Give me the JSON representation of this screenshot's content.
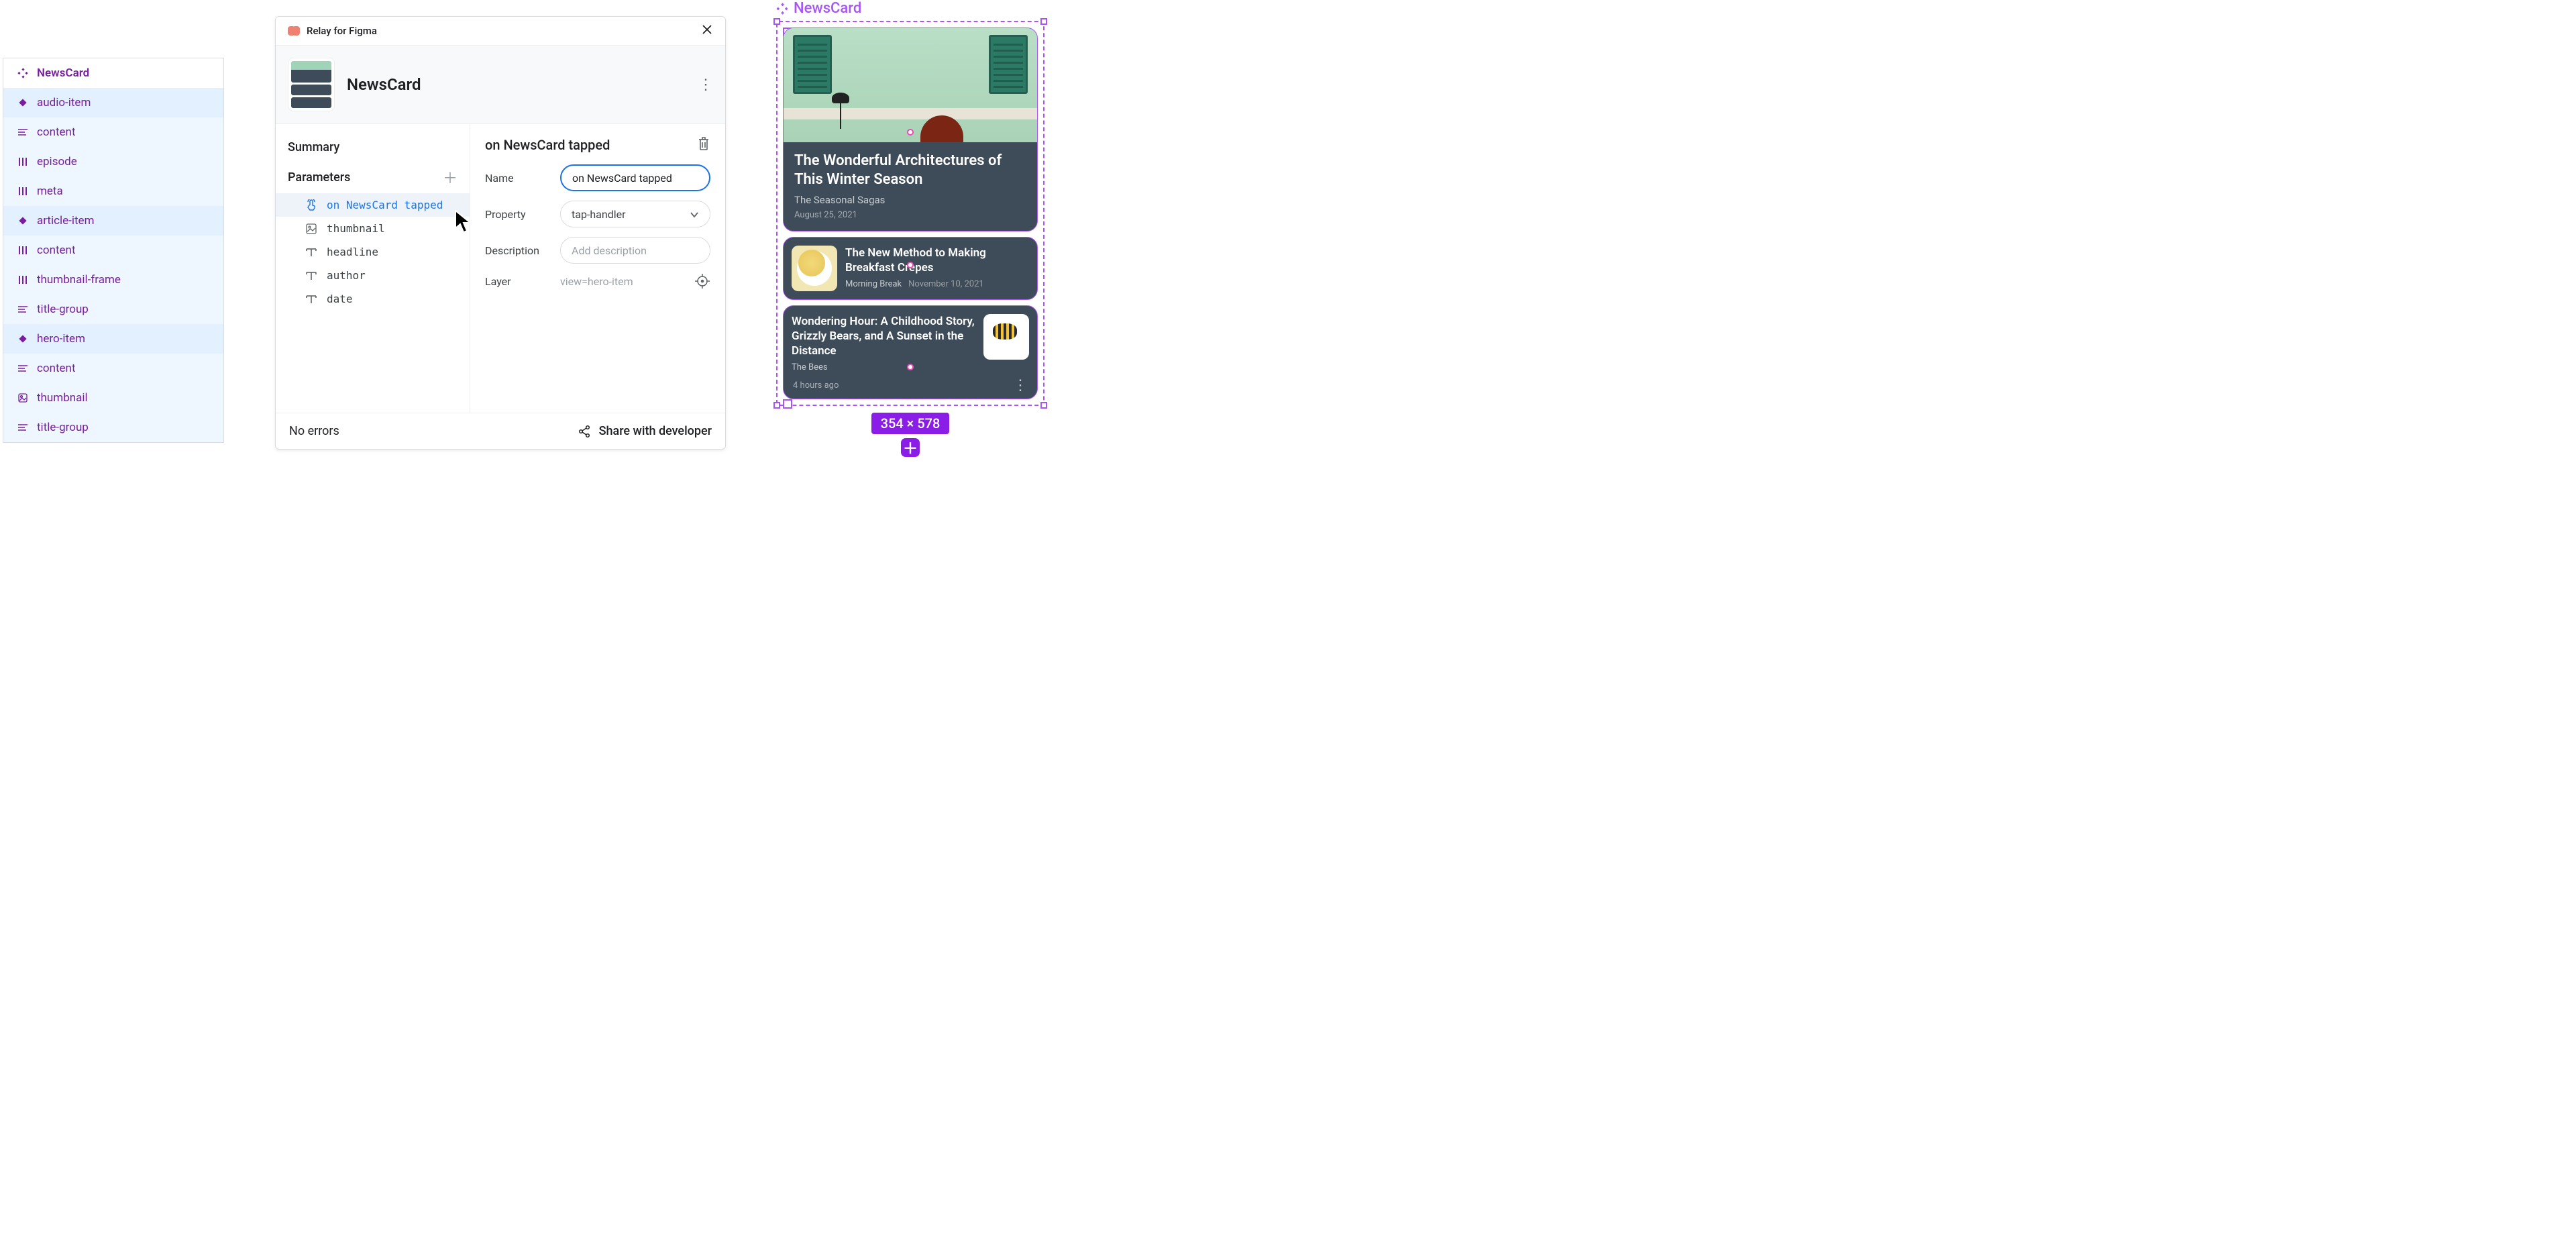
{
  "layers": {
    "component": "NewsCard",
    "items": [
      {
        "label": "audio-item",
        "icon": "diamond",
        "indent": 2,
        "selected": true
      },
      {
        "label": "content",
        "icon": "lines",
        "indent": 3,
        "selected": false
      },
      {
        "label": "episode",
        "icon": "bars",
        "indent": 4,
        "selected": false
      },
      {
        "label": "meta",
        "icon": "bars",
        "indent": 4,
        "selected": false
      },
      {
        "label": "article-item",
        "icon": "diamond",
        "indent": 2,
        "selected": true
      },
      {
        "label": "content",
        "icon": "bars",
        "indent": 3,
        "selected": false
      },
      {
        "label": "thumbnail-frame",
        "icon": "bars",
        "indent": 4,
        "selected": false
      },
      {
        "label": "title-group",
        "icon": "lines",
        "indent": 4,
        "selected": false
      },
      {
        "label": "hero-item",
        "icon": "diamond",
        "indent": 2,
        "selected": true
      },
      {
        "label": "content",
        "icon": "lines",
        "indent": 3,
        "selected": false
      },
      {
        "label": "thumbnail",
        "icon": "image",
        "indent": 4,
        "selected": false
      },
      {
        "label": "title-group",
        "icon": "lines",
        "indent": 4,
        "selected": false
      }
    ]
  },
  "plugin": {
    "title": "Relay for Figma",
    "component": "NewsCard",
    "left": {
      "summary": "Summary",
      "parameters": "Parameters",
      "params": [
        {
          "name": "on NewsCard tapped",
          "icon": "tap",
          "selected": true
        },
        {
          "name": "thumbnail",
          "icon": "image",
          "selected": false
        },
        {
          "name": "headline",
          "icon": "text",
          "selected": false
        },
        {
          "name": "author",
          "icon": "text",
          "selected": false
        },
        {
          "name": "date",
          "icon": "text",
          "selected": false
        }
      ]
    },
    "right": {
      "heading": "on NewsCard tapped",
      "name_label": "Name",
      "name_value": "on NewsCard tapped",
      "property_label": "Property",
      "property_value": "tap-handler",
      "description_label": "Description",
      "description_placeholder": "Add description",
      "layer_label": "Layer",
      "layer_value": "view=hero-item"
    },
    "footer": {
      "status": "No errors",
      "share": "Share with developer"
    }
  },
  "canvas": {
    "label": "NewsCard",
    "hero": {
      "headline": "The Wonderful Architectures of This Winter Season",
      "author": "The Seasonal Sagas",
      "date": "August 25, 2021"
    },
    "mid": {
      "headline": "The New Method to Making Breakfast Crepes",
      "author": "Morning Break",
      "date": "November 10, 2021"
    },
    "last": {
      "headline": "Wondering Hour: A Childhood Story, Grizzly Bears, and A Sunset in the Distance",
      "author": "The Bees",
      "date": "4 hours ago"
    },
    "dims": "354 × 578"
  }
}
